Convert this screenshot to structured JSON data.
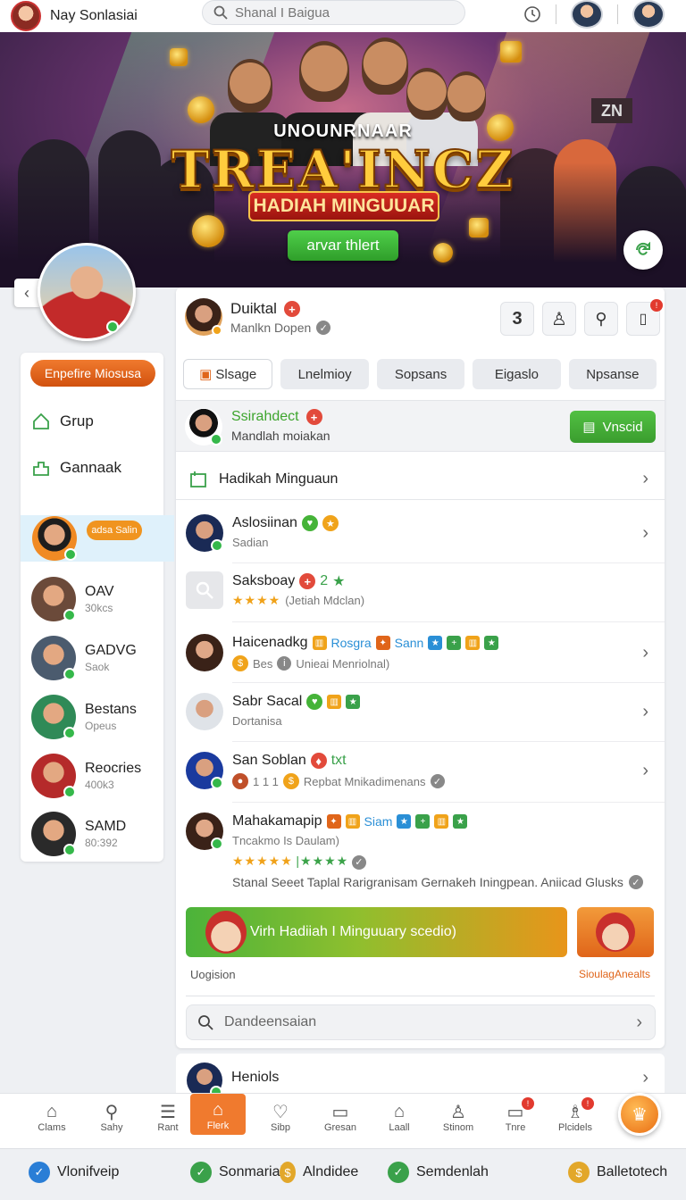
{
  "topbar": {
    "user_name": "Nay Sonlasiai",
    "search_placeholder": "Shanal I Baigua"
  },
  "banner": {
    "kicker": "UNOUNRNAAR",
    "title": "TREA'INCZ",
    "subtitle": "HADIAH MINGUUAR",
    "button_label": "arvar thlert",
    "sign_text": "ZN"
  },
  "sidebar": {
    "pill_label": "Enpefire Miosusa",
    "links": [
      {
        "label": "Grup",
        "icon": "home-icon"
      },
      {
        "label": "Gannaak",
        "icon": "group-icon"
      }
    ],
    "highlight_tag": "adsa Salin",
    "friends": [
      {
        "name": "OAV",
        "sub": "30kcs",
        "color": "#6b4a3a"
      },
      {
        "name": "GADVG",
        "sub": "Saok",
        "color": "#4b5b6e"
      },
      {
        "name": "Bestans",
        "sub": "Opeus",
        "color": "#2f8a57"
      },
      {
        "name": "Reocries",
        "sub": "400k3",
        "color": "#b52a2a"
      },
      {
        "name": "SAMD",
        "sub": "80:392",
        "color": "#2a2a2a"
      }
    ]
  },
  "main": {
    "header": {
      "name": "Duiktal",
      "sub": "Manlkn Dopen",
      "count": "3"
    },
    "tabs": [
      "Slsage",
      "Lnelmioy",
      "Sopsans",
      "Eigaslo",
      "Npsanse"
    ],
    "suggest": {
      "name": "Ssirahdect",
      "sub": "Mandlah moiakan",
      "button": "Vnscid"
    },
    "section_title": "Hadikah Minguaun",
    "items": [
      {
        "name": "Aslosiinan",
        "sub": "Sadian"
      },
      {
        "name": "Saksboay",
        "badge": "2",
        "sub": "(Jetiah Mdclan)"
      },
      {
        "name": "Haicenadkg",
        "tag1": "Rosgra",
        "tag2": "Sann",
        "sub": "Bes",
        "sub2": "Unieai Menriolnal)"
      },
      {
        "name": "Sabr Sacal",
        "sub": "Dortanisa"
      },
      {
        "name": "San Soblan",
        "tag": "txt",
        "sub": "1 1 1",
        "sub2": "Repbat Mnikadimenans"
      },
      {
        "name": "Mahakamapip",
        "tag": "Siam",
        "sub": "Tncakmo Is Daulam)",
        "footnote": "Stanal Seeet Taplal Rarigranisam Gernakeh Iningpean. Aniicad Glusks"
      }
    ],
    "promo": {
      "text": "Virh Hadiiah I Minguuary scedio)",
      "label_left": "Uogision",
      "label_right": "SioulagAnealts"
    },
    "search_placeholder": "Dandeensaian",
    "next_card": "Heniols"
  },
  "bottom_nav": [
    {
      "label": "Clams",
      "icon": "home-icon"
    },
    {
      "label": "Sahy",
      "icon": "search-icon"
    },
    {
      "label": "Rant",
      "icon": "list-icon"
    },
    {
      "label": "Flerk",
      "icon": "home-icon"
    },
    {
      "label": "Sibp",
      "icon": "heart-icon"
    },
    {
      "label": "Gresan",
      "icon": "window-icon"
    },
    {
      "label": "Laall",
      "icon": "home-icon"
    },
    {
      "label": "Stinom",
      "icon": "person-icon"
    },
    {
      "label": "Tnre",
      "icon": "inbox-icon"
    },
    {
      "label": "Plcidels",
      "icon": "people-icon"
    }
  ],
  "footer": [
    {
      "label": "Vlonifveip",
      "color": "#2a7ed6"
    },
    {
      "label": "Sonmarial",
      "color": "#3aa14a"
    },
    {
      "label": "Alndidee",
      "color": "#e2a72a"
    },
    {
      "label": "Semdenlah",
      "color": "#3aa14a"
    },
    {
      "label": "Balletotech",
      "color": "#e2a72a"
    }
  ],
  "colors": {
    "accent": "#f07a2e",
    "green": "#45b338",
    "red": "#e24a3b"
  }
}
